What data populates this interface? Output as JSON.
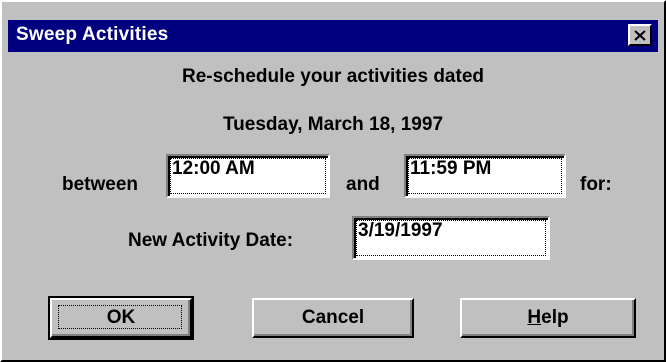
{
  "window": {
    "title": "Sweep Activities",
    "close_glyph": "✕"
  },
  "prompt": {
    "line1": "Re-schedule your activities dated",
    "date": "Tuesday, March 18, 1997",
    "between_label": "between",
    "start_time": "12:00 AM",
    "and_label": "and",
    "end_time": "11:59 PM",
    "for_label": "for:",
    "new_date_label": "New Activity Date:",
    "new_date_value": "3/19/1997"
  },
  "buttons": {
    "ok": "OK",
    "cancel": "Cancel",
    "help_accel": "H",
    "help_rest": "elp"
  },
  "colors": {
    "titlebar": "#000080",
    "face": "#c0c0c0"
  }
}
